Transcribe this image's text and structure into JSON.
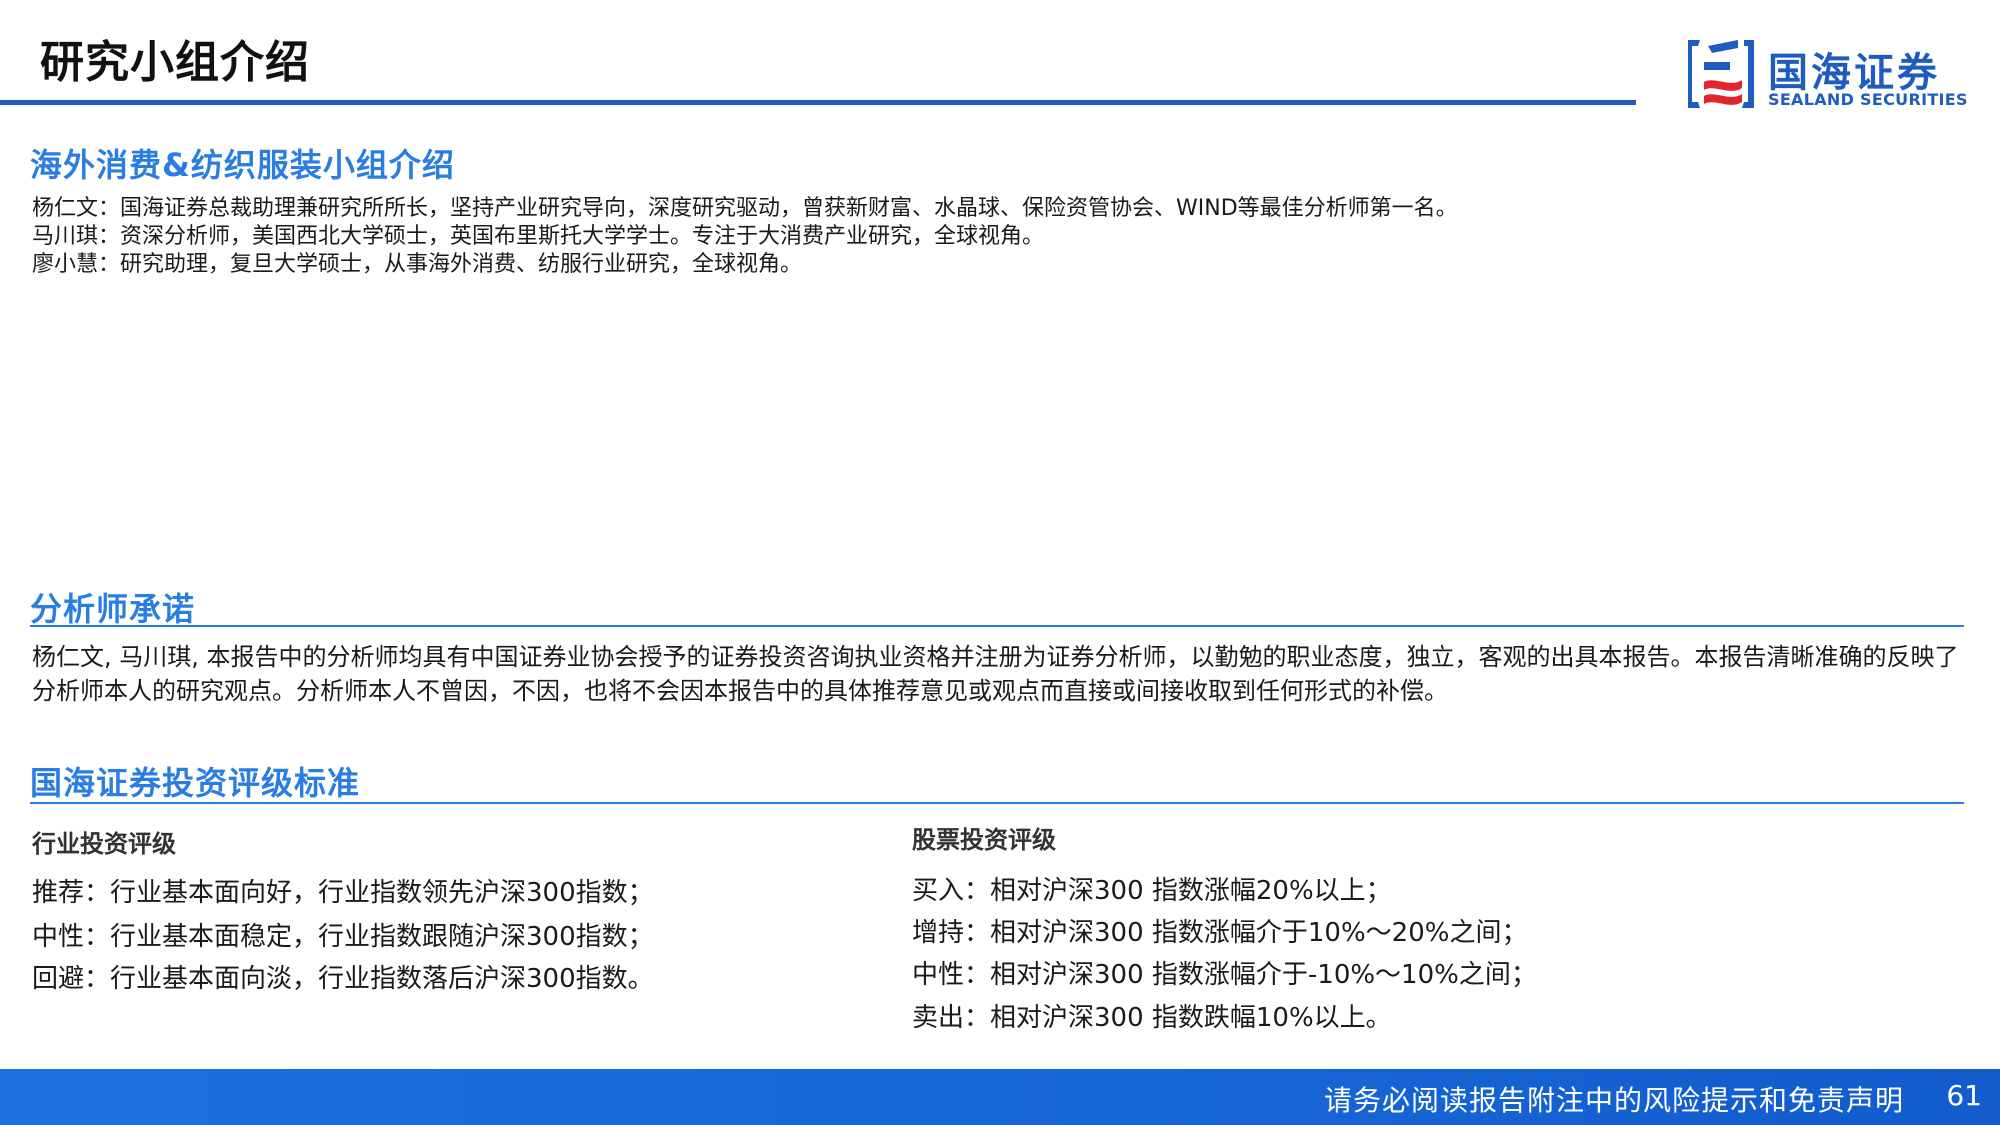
{
  "header": {
    "title": "研究小组介绍",
    "logo": {
      "name_cn": "国海证券",
      "name_en": "SEALAND SECURITIES",
      "icon": "sealand-logo-icon"
    }
  },
  "team_section": {
    "title": "海外消费&纺织服装小组介绍",
    "members": [
      "杨仁文：国海证券总裁助理兼研究所所长，坚持产业研究导向，深度研究驱动，曾获新财富、水晶球、保险资管协会、WIND等最佳分析师第一名。",
      "马川琪：资深分析师，美国西北大学硕士，英国布里斯托大学学士。专注于大消费产业研究，全球视角。",
      "廖小慧：研究助理，复旦大学硕士，从事海外消费、纺服行业研究，全球视角。"
    ]
  },
  "commitment_section": {
    "title": "分析师承诺",
    "text": "杨仁文, 马川琪, 本报告中的分析师均具有中国证券业协会授予的证券投资咨询执业资格并注册为证券分析师，以勤勉的职业态度，独立，客观的出具本报告。本报告清晰准确的反映了分析师本人的研究观点。分析师本人不曾因，不因，也将不会因本报告中的具体推荐意见或观点而直接或间接收取到任何形式的补偿。"
  },
  "rating_section": {
    "title": "国海证券投资评级标准",
    "industry": {
      "heading": "行业投资评级",
      "items": [
        "推荐：行业基本面向好，行业指数领先沪深300指数；",
        "中性：行业基本面稳定，行业指数跟随沪深300指数；",
        "回避：行业基本面向淡，行业指数落后沪深300指数。"
      ]
    },
    "stock": {
      "heading": "股票投资评级",
      "items": [
        "买入：相对沪深300 指数涨幅20%以上；",
        "增持：相对沪深300 指数涨幅介于10%～20%之间；",
        "中性：相对沪深300 指数涨幅介于-10%～10%之间；",
        "卖出：相对沪深300 指数跌幅10%以上。"
      ]
    }
  },
  "footer": {
    "disclaimer": "请务必阅读报告附注中的风险提示和免责声明",
    "page_number": "61"
  },
  "colors": {
    "brand_blue": "#1f5cbf",
    "section_blue": "#2a7de1",
    "logo_red": "#e0262a"
  }
}
